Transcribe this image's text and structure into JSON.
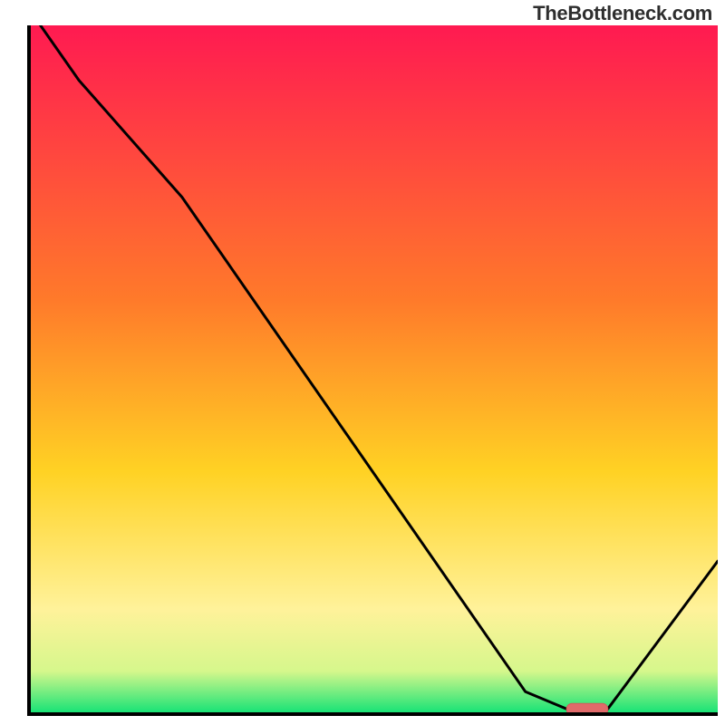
{
  "watermark": "TheBottleneck.com",
  "colors": {
    "gradient_top": "#ff1a51",
    "gradient_mid1": "#ff7a2a",
    "gradient_mid2": "#ffd224",
    "gradient_mid3": "#fff29a",
    "gradient_mid4": "#d6f78c",
    "gradient_bottom": "#19e376",
    "curve": "#000000",
    "marker_fill": "#e06a6a",
    "marker_stroke": "#d35a5a"
  },
  "chart_data": {
    "type": "line",
    "title": "",
    "xlabel": "",
    "ylabel": "",
    "xlim": [
      0,
      100
    ],
    "ylim": [
      0,
      100
    ],
    "grid": false,
    "x": [
      0,
      7,
      22,
      72,
      78,
      84,
      100
    ],
    "values": [
      102,
      92,
      75,
      3,
      0.5,
      0.5,
      22
    ],
    "marker": {
      "x_start": 78,
      "x_end": 84,
      "y": 0.5
    },
    "notes": "x and y are percentages of plot width/height; y=0 at bottom (green), y=100 at top (red). Curve descends from top-left, flattens near x≈78–84 at y≈0.5, then rises to bottom-right."
  }
}
